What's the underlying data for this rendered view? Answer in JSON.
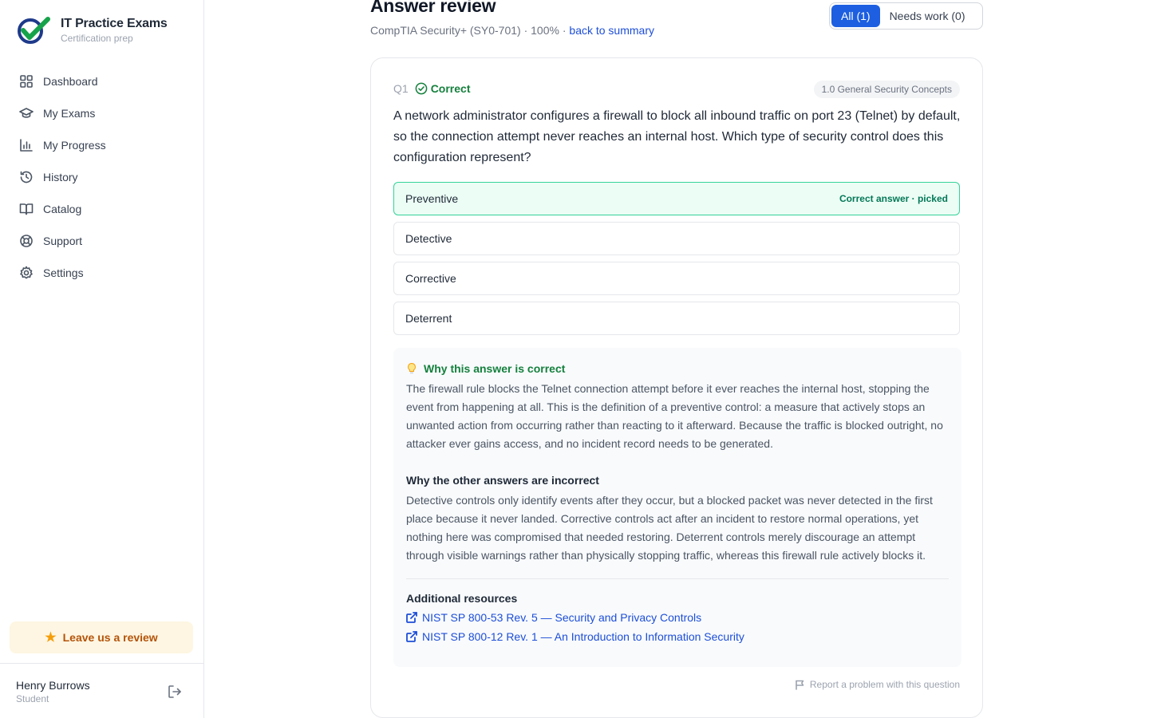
{
  "brand": {
    "title": "IT Practice Exams",
    "subtitle": "Certification prep",
    "accent": "#16a34a",
    "dark": "#1e3a8a"
  },
  "sidebar": {
    "items": [
      {
        "label": "Dashboard",
        "icon": "grid-icon"
      },
      {
        "label": "My Exams",
        "icon": "graduation-cap-icon"
      },
      {
        "label": "My Progress",
        "icon": "bar-chart-icon"
      },
      {
        "label": "History",
        "icon": "history-icon"
      },
      {
        "label": "Catalog",
        "icon": "book-open-icon"
      },
      {
        "label": "Support",
        "icon": "lifebuoy-icon"
      },
      {
        "label": "Settings",
        "icon": "gear-icon"
      }
    ],
    "review_button": "Leave us a review"
  },
  "user": {
    "name": "Henry Burrows",
    "role": "Student"
  },
  "header": {
    "title": "Answer review",
    "exam": "CompTIA Security+ (SY0-701)",
    "score": "100%",
    "separator": " · ",
    "back_link": "back to summary"
  },
  "filter": {
    "all": "All (1)",
    "needs_work": "Needs work (0)",
    "active": "all",
    "active_color": "#1d5fe0"
  },
  "question": {
    "number": "Q1",
    "status": "Correct",
    "category": "1.0 General Security Concepts",
    "text": "A network administrator configures a firewall to block all inbound traffic on port 23 (Telnet) by default, so the connection attempt never reaches an internal host. Which type of security control does this configuration represent?",
    "options": [
      {
        "label": "Preventive",
        "badge": "Correct answer · picked",
        "state": "correct"
      },
      {
        "label": "Detective",
        "badge": "",
        "state": "normal"
      },
      {
        "label": "Corrective",
        "badge": "",
        "state": "normal"
      },
      {
        "label": "Deterrent",
        "badge": "",
        "state": "normal"
      }
    ]
  },
  "explanation": {
    "correct_heading": "Why this answer is correct",
    "correct_text": "The firewall rule blocks the Telnet connection attempt before it ever reaches the internal host, stopping the event from happening at all. This is the definition of a preventive control: a measure that actively stops an unwanted action from occurring rather than reacting to it afterward. Because the traffic is blocked outright, no attacker ever gains access, and no incident record needs to be generated.",
    "incorrect_heading": "Why the other answers are incorrect",
    "incorrect_text": "Detective controls only identify events after they occur, but a blocked packet was never detected in the first place because it never landed. Corrective controls act after an incident to restore normal operations, yet nothing here was compromised that needed restoring. Deterrent controls merely discourage an attempt through visible warnings rather than physically stopping traffic, whereas this firewall rule actively blocks it.",
    "resources_heading": "Additional resources",
    "resources": [
      "NIST SP 800-53 Rev. 5 — Security and Privacy Controls",
      "NIST SP 800-12 Rev. 1 — An Introduction to Information Security"
    ]
  },
  "report_link": "Report a problem with this question"
}
